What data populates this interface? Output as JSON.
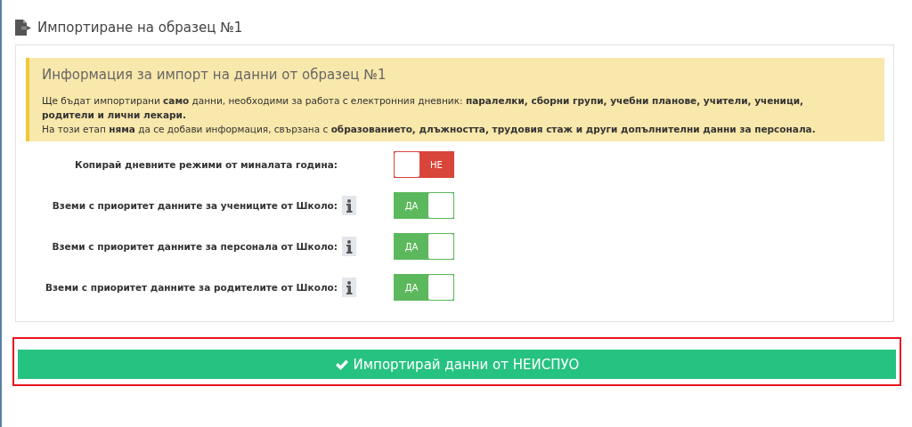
{
  "header": {
    "title": "Импортиране на образец №1"
  },
  "info": {
    "title": "Информация за импорт на данни от образец №1",
    "paragraphs": [
      "Ще бъдат импортирани **само** данни, необходими за работа с електронния дневник: **паралелки, сборни групи, учебни планове, учители, ученици, родители и лични лекари.**",
      "На този етап **няма** да се добави информация, свързана с **образованието, длъжността, трудовия стаж и други допълнителни данни за персонала.**"
    ]
  },
  "options": [
    {
      "label": "Копирай дневните режими от миналата година:",
      "info": false,
      "on": false,
      "state_text": "НЕ"
    },
    {
      "label": "Вземи с приоритет данните за учениците от Школо:",
      "info": true,
      "on": true,
      "state_text": "ДА"
    },
    {
      "label": "Вземи с приоритет данните за персонала от Школо:",
      "info": true,
      "on": true,
      "state_text": "ДА"
    },
    {
      "label": "Вземи с приоритет данните за родителите от Школо:",
      "info": true,
      "on": true,
      "state_text": "ДА"
    }
  ],
  "import_button": {
    "label": "Импортирай данни от НЕИСПУО"
  }
}
